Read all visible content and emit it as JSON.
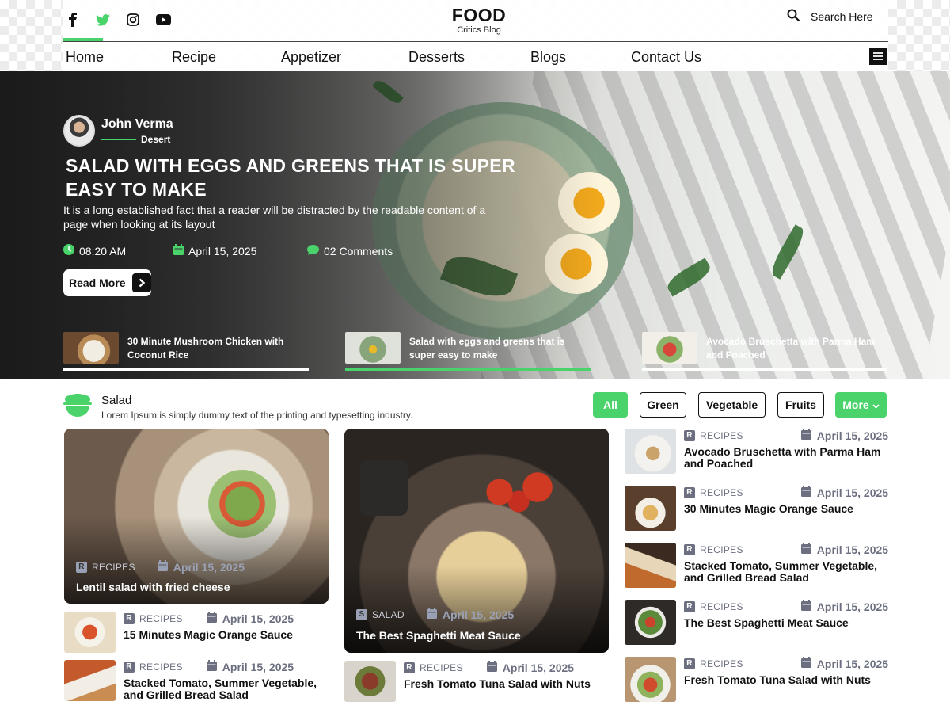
{
  "header": {
    "logo_title": "FOOD",
    "logo_subtitle": "Critics Blog",
    "search_placeholder": "Search Here",
    "social": [
      "facebook-icon",
      "twitter-icon",
      "instagram-icon",
      "youtube-icon"
    ],
    "nav": [
      "Home",
      "Recipe",
      "Appetizer",
      "Desserts",
      "Blogs",
      "Contact Us"
    ],
    "active_nav": "Home"
  },
  "hero": {
    "author_name": "John Verma",
    "author_category": "Desert",
    "title": "SALAD WITH EGGS AND GREENS THAT IS SUPER EASY TO MAKE",
    "description": "It is a long established fact that a reader will be distracted by the readable content of a page when looking at its layout",
    "time": "08:20 AM",
    "date": "April 15, 2025",
    "comments": "02 Comments",
    "read_more": "Read More",
    "cards": [
      {
        "title": "30 Minute Mushroom Chicken with Coconut Rice"
      },
      {
        "title": "Salad with eggs and greens that is super easy to make"
      },
      {
        "title": "Avocado Bruschetta with Parma Ham and Poached"
      }
    ]
  },
  "salad": {
    "title": "Salad",
    "subtitle": "Lorem Ipsum is simply dummy text of the printing and typesetting industry.",
    "filters": [
      "All",
      "Green",
      "Vegetable",
      "Fruits",
      "More"
    ],
    "col1": {
      "big": {
        "letter": "R",
        "category": "RECIPES",
        "date": "April 15, 2025",
        "title": "Lentil salad with fried cheese"
      },
      "items": [
        {
          "letter": "R",
          "category": "RECIPES",
          "date": "April 15, 2025",
          "title": "15 Minutes Magic Orange Sauce"
        },
        {
          "letter": "R",
          "category": "RECIPES",
          "date": "April 15, 2025",
          "title": "Stacked Tomato, Summer Vegetable, and Grilled Bread Salad"
        }
      ]
    },
    "col2": {
      "big": {
        "letter": "S",
        "category": "SALAD",
        "date": "April 15, 2025",
        "title": "The Best Spaghetti Meat Sauce"
      },
      "items": [
        {
          "letter": "R",
          "category": "RECIPES",
          "date": "April 15, 2025",
          "title": "Fresh Tomato Tuna Salad with Nuts"
        }
      ]
    },
    "col3": [
      {
        "letter": "R",
        "category": "RECIPES",
        "date": "April 15, 2025",
        "title": "Avocado Bruschetta with Parma Ham and Poached"
      },
      {
        "letter": "R",
        "category": "RECIPES",
        "date": "April 15, 2025",
        "title": "30 Minutes Magic Orange Sauce"
      },
      {
        "letter": "R",
        "category": "RECIPES",
        "date": "April 15, 2025",
        "title": "Stacked Tomato, Summer Vegetable, and Grilled Bread Salad"
      },
      {
        "letter": "R",
        "category": "RECIPES",
        "date": "April 15, 2025",
        "title": "The Best Spaghetti Meat Sauce"
      },
      {
        "letter": "R",
        "category": "RECIPES",
        "date": "April 15, 2025",
        "title": "Fresh Tomato Tuna Salad with Nuts"
      }
    ]
  },
  "colors": {
    "accent": "#4bd36b",
    "dark": "#111111",
    "meta": "#6b6f80"
  }
}
